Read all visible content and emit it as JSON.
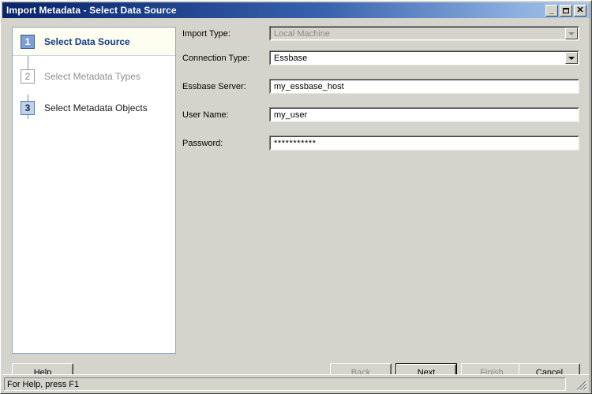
{
  "window": {
    "title": "Import Metadata - Select Data Source",
    "minimize_label": "_",
    "maximize_label": "□",
    "close_label": "✕"
  },
  "steps": {
    "items": [
      {
        "number": "1",
        "label": "Select Data Source",
        "state": "active"
      },
      {
        "number": "2",
        "label": "Select Metadata Types",
        "state": "disabled"
      },
      {
        "number": "3",
        "label": "Select Metadata Objects",
        "state": "pending"
      }
    ]
  },
  "form": {
    "fields": [
      {
        "label": "Import Type:",
        "value": "Local Machine",
        "type": "combobox",
        "enabled": false
      },
      {
        "label": "Connection Type:",
        "value": "Essbase",
        "type": "combobox",
        "enabled": true
      },
      {
        "label": "Essbase Server:",
        "value": "my_essbase_host",
        "type": "text",
        "enabled": true
      },
      {
        "label": "User Name:",
        "value": "my_user",
        "type": "text",
        "enabled": true
      },
      {
        "label": "Password:",
        "value": "***********",
        "type": "password",
        "enabled": true
      }
    ]
  },
  "buttons": {
    "help": {
      "label": "Help",
      "enabled": true,
      "default": false
    },
    "back": {
      "label": "Back",
      "enabled": false,
      "default": false
    },
    "next": {
      "label": "Next",
      "enabled": true,
      "default": true
    },
    "finish": {
      "label": "Finish",
      "enabled": false,
      "default": false
    },
    "cancel": {
      "label": "Cancel",
      "enabled": true,
      "default": false
    }
  },
  "statusbar": {
    "text": "For Help, press F1"
  },
  "colors": {
    "window_bg": "#d4d4cc",
    "title_start": "#0a246a",
    "title_end": "#a7c5ea",
    "step_active_text": "#123a86",
    "step_active_box": "#7d9fd4",
    "step_pending_box": "#bed2ec",
    "panel_border": "#8fa8c8",
    "disabled_text": "#8a8a8a"
  }
}
